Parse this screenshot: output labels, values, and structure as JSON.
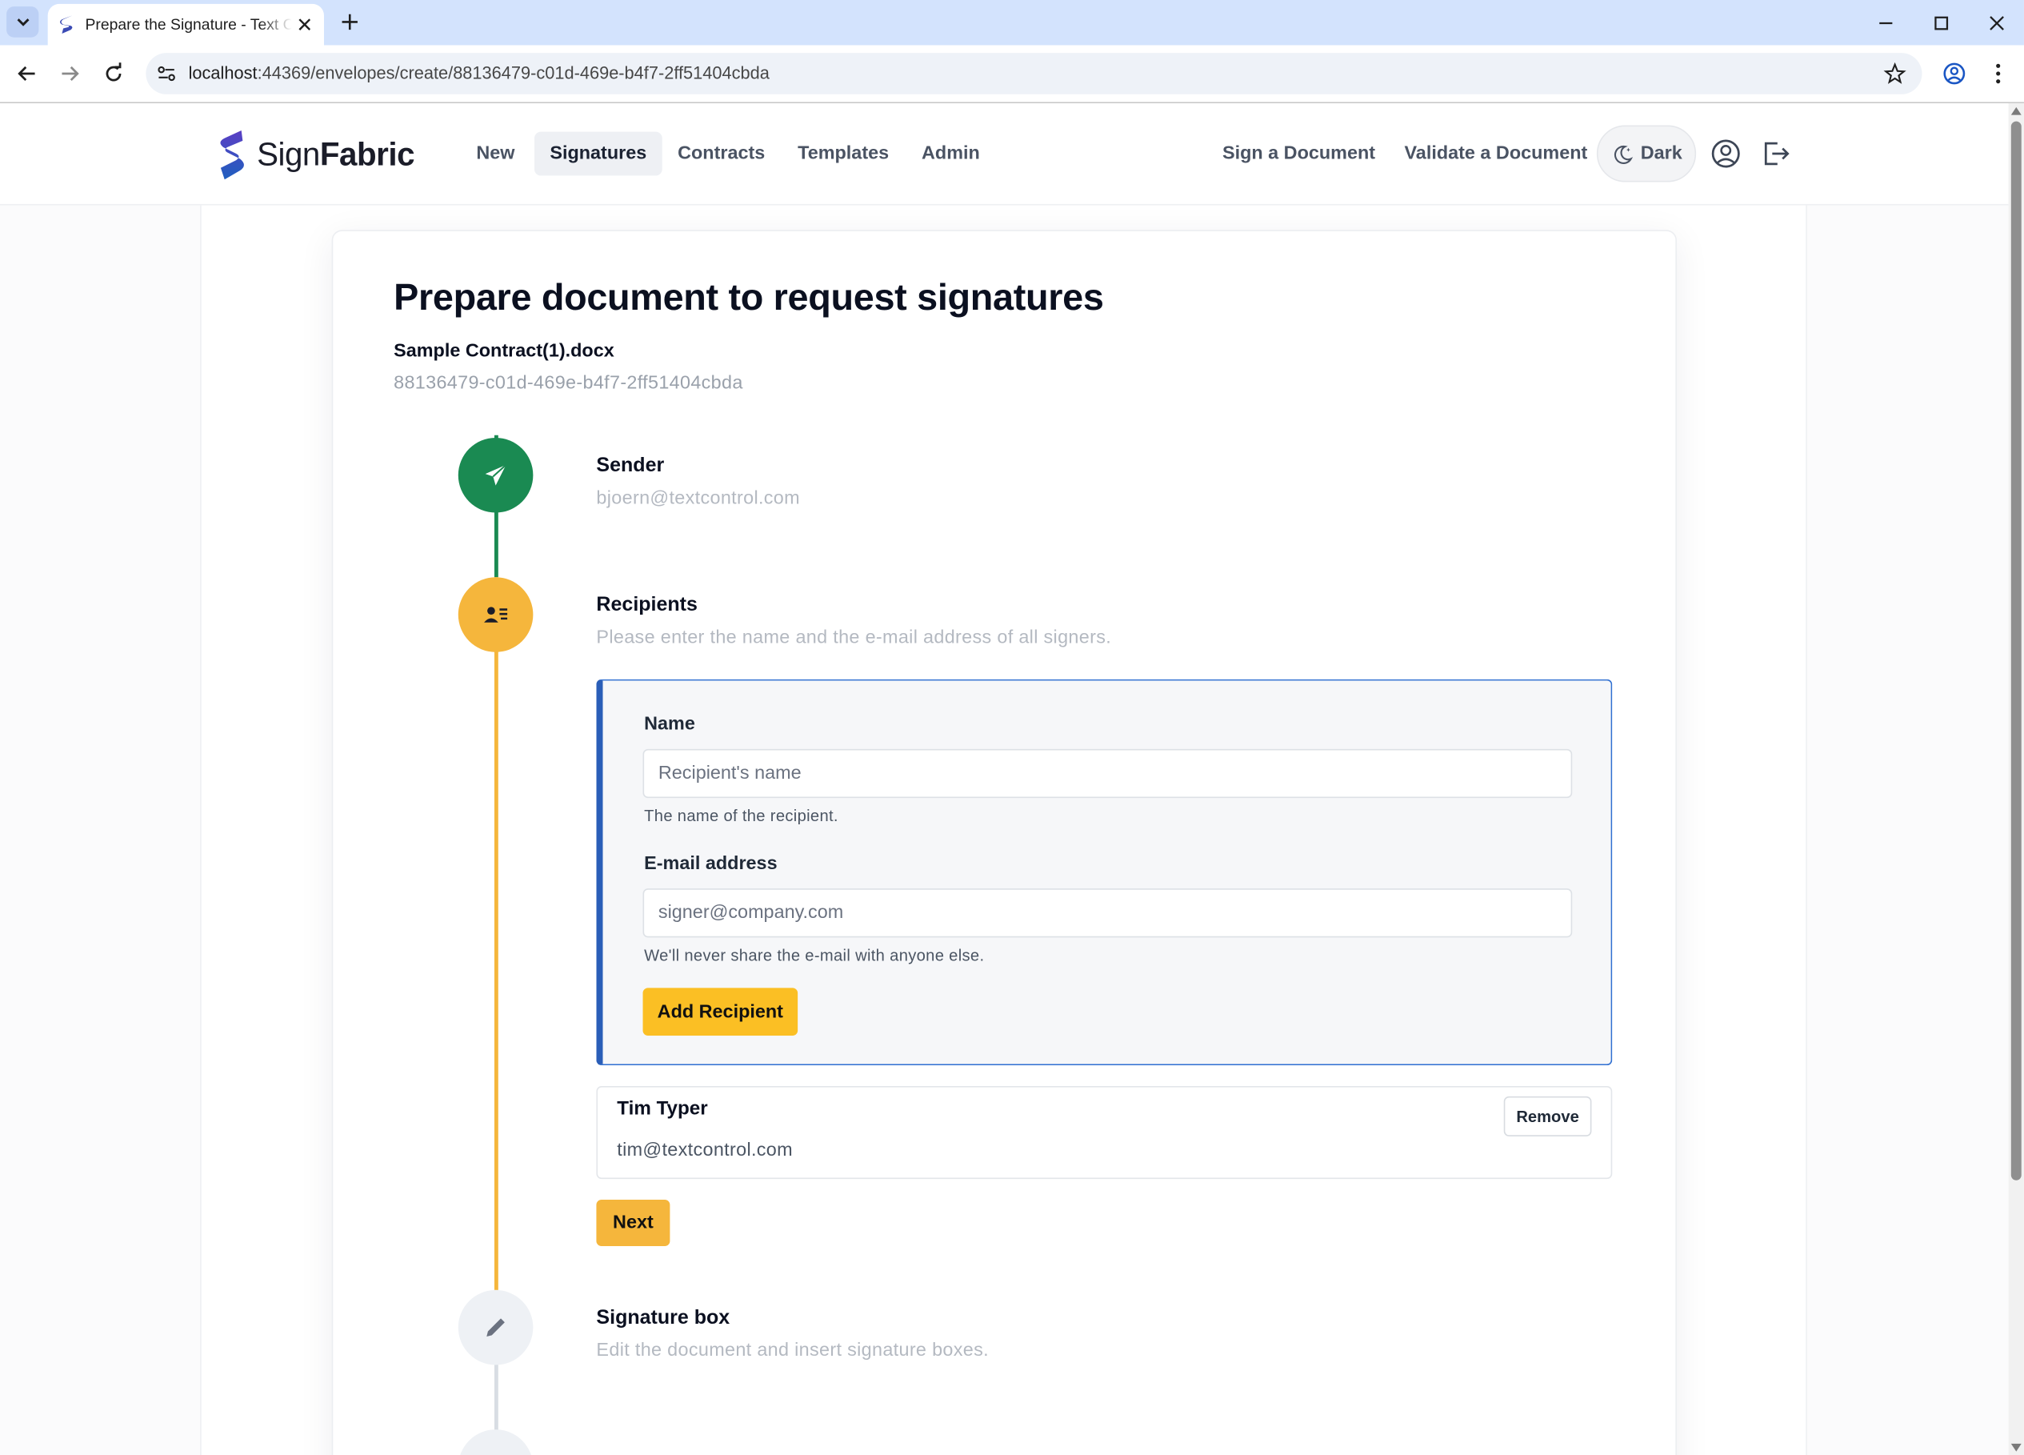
{
  "browser": {
    "tab_title": "Prepare the Signature - Text Control",
    "url_host": "localhost",
    "url_path": ":44369/envelopes/create/88136479-c01d-469e-b4f7-2ff51404cbda"
  },
  "brand": {
    "name_light": "Sign",
    "name_bold": "Fabric"
  },
  "nav": {
    "items": [
      {
        "label": "New"
      },
      {
        "label": "Signatures"
      },
      {
        "label": "Contracts"
      },
      {
        "label": "Templates"
      },
      {
        "label": "Admin"
      }
    ],
    "active": "Signatures",
    "sign_document": "Sign a Document",
    "validate_document": "Validate a Document",
    "theme_toggle": "Dark"
  },
  "page": {
    "title": "Prepare document to request signatures",
    "file_name": "Sample Contract(1).docx",
    "envelope_id": "88136479-c01d-469e-b4f7-2ff51404cbda"
  },
  "steps": {
    "sender": {
      "title": "Sender",
      "value": "bjoern@textcontrol.com",
      "icon": "paper-plane-icon",
      "color": "#1a8a52"
    },
    "recipients": {
      "title": "Recipients",
      "description": "Please enter the name and the e-mail address of all signers.",
      "icon": "address-card-icon",
      "color": "#f5b63c"
    },
    "signature_box": {
      "title": "Signature box",
      "description": "Edit the document and insert signature boxes.",
      "icon": "pen-icon",
      "color": "#eef1f5"
    }
  },
  "form": {
    "name_label": "Name",
    "name_placeholder": "Recipient's name",
    "name_help": "The name of the recipient.",
    "email_label": "E-mail address",
    "email_placeholder": "signer@company.com",
    "email_help": "We'll never share the e-mail with anyone else.",
    "add_button": "Add Recipient"
  },
  "recipients": [
    {
      "name": "Tim Typer",
      "email": "tim@textcontrol.com",
      "remove_label": "Remove"
    }
  ],
  "next_button": "Next",
  "colors": {
    "accent_yellow": "#fbbf24",
    "next_yellow": "#f5b63c",
    "sender_green": "#1a8a52",
    "brand_blue": "#2a5eb8"
  }
}
